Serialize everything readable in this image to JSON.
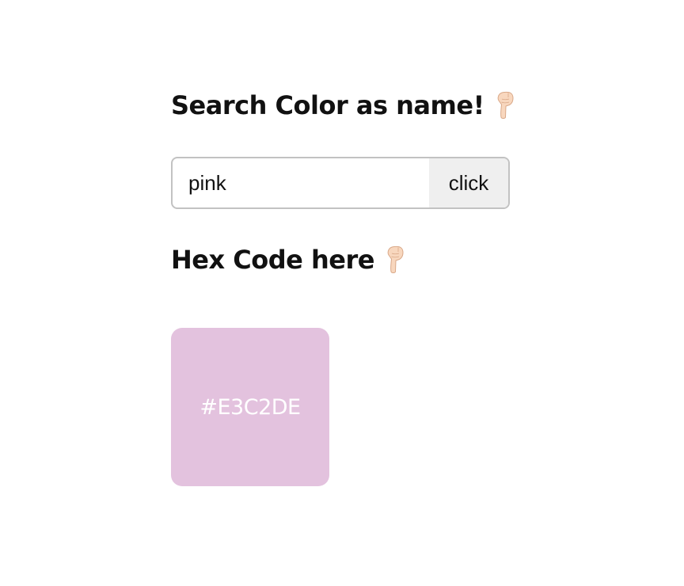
{
  "search_section": {
    "heading": "Search Color as name!",
    "heading_icon": "pointing-down-hand-icon"
  },
  "search": {
    "value": "pink",
    "placeholder": "",
    "button_label": "click"
  },
  "result_section": {
    "heading": "Hex Code here",
    "heading_icon": "pointing-down-hand-icon"
  },
  "result": {
    "hex_code": "#E3C2DE",
    "swatch_color": "#E3C2DE",
    "label_color": "#FFFFFF"
  }
}
